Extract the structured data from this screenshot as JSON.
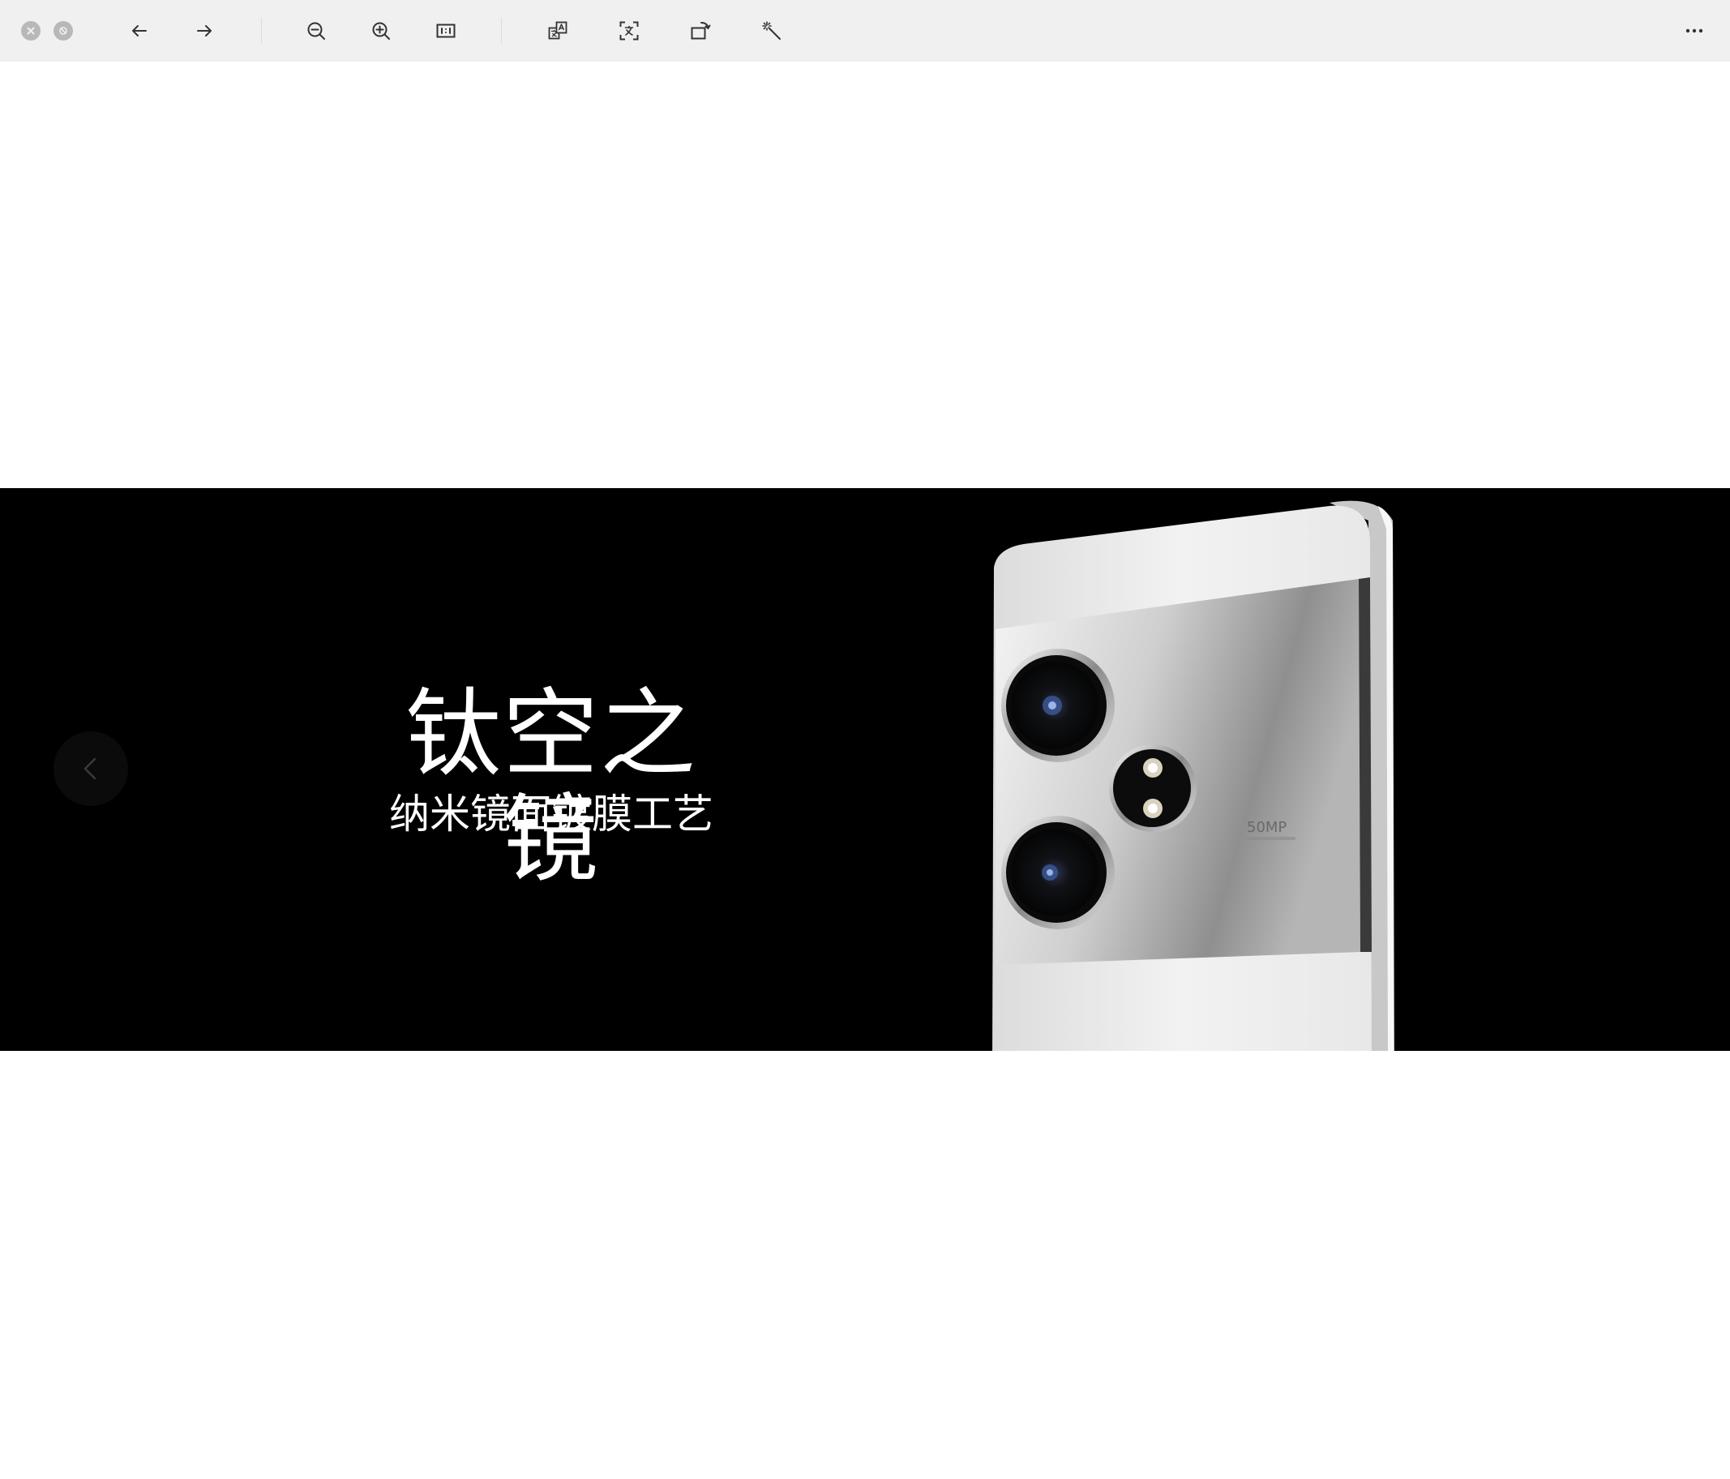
{
  "toolbar": {
    "close_icon": "close-icon",
    "minimize_icon": "minimize-icon",
    "back_icon": "arrow-left-icon",
    "forward_icon": "arrow-right-icon",
    "zoom_out_icon": "zoom-out-icon",
    "zoom_in_icon": "zoom-in-icon",
    "actual_size_icon": "actual-size-icon",
    "translate_icon": "translate-icon",
    "ocr_icon": "text-recognition-icon",
    "rotate_icon": "rotate-icon",
    "enhance_icon": "magic-wand-icon",
    "more_icon": "more-icon"
  },
  "banner": {
    "headline": "钛空之镜",
    "subline": "纳米镜面镀膜工艺",
    "prev_icon": "chevron-left-icon",
    "phone_badge": "50MP",
    "background": "#000000",
    "text_color": "#ffffff"
  },
  "colors": {
    "toolbar_bg": "#f0f0f0",
    "icon_color": "#333333",
    "page_bg": "#ffffff"
  }
}
